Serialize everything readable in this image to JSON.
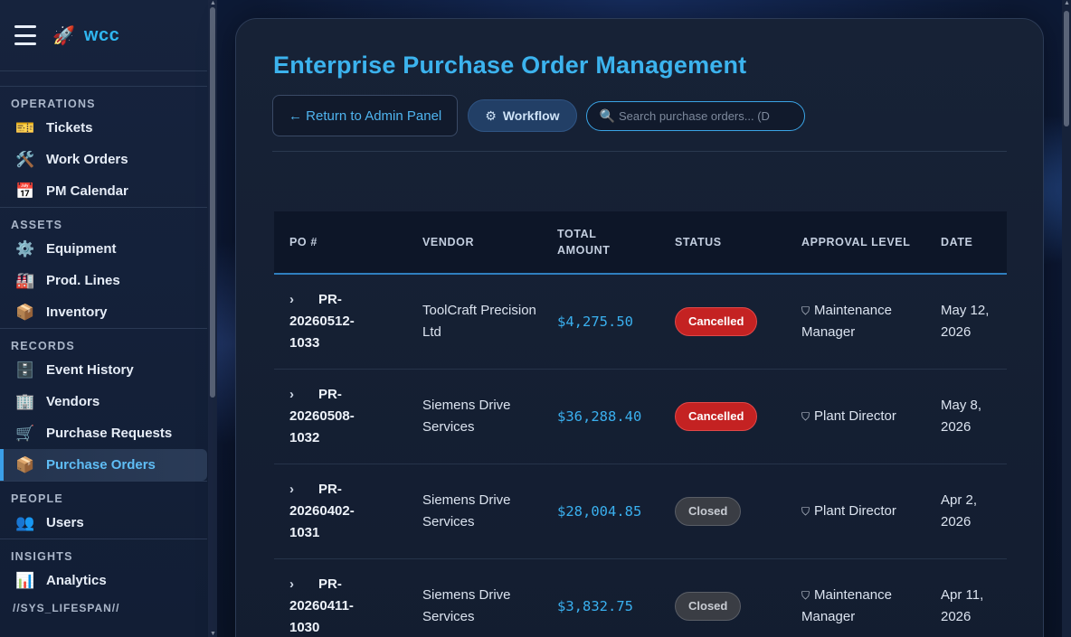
{
  "brand": {
    "name": "wcc",
    "icon": "rocket-icon"
  },
  "sidebar": {
    "sections": [
      {
        "title": "OPERATIONS",
        "items": [
          {
            "label": "Tickets",
            "icon": "🎫"
          },
          {
            "label": "Work Orders",
            "icon": "🛠️"
          },
          {
            "label": "PM Calendar",
            "icon": "📅"
          }
        ]
      },
      {
        "title": "ASSETS",
        "items": [
          {
            "label": "Equipment",
            "icon": "⚙️"
          },
          {
            "label": "Prod. Lines",
            "icon": "🏭"
          },
          {
            "label": "Inventory",
            "icon": "📦"
          }
        ]
      },
      {
        "title": "RECORDS",
        "items": [
          {
            "label": "Event History",
            "icon": "🗄️"
          },
          {
            "label": "Vendors",
            "icon": "🏢"
          },
          {
            "label": "Purchase Requests",
            "icon": "🛒"
          },
          {
            "label": "Purchase Orders",
            "icon": "📦"
          }
        ]
      },
      {
        "title": "PEOPLE",
        "items": [
          {
            "label": "Users",
            "icon": "👥"
          }
        ]
      },
      {
        "title": "INSIGHTS",
        "items": [
          {
            "label": "Analytics",
            "icon": "📊"
          }
        ]
      }
    ],
    "active": "Purchase Orders",
    "footer": "//SYS_LIFESPAN//"
  },
  "page": {
    "title": "Enterprise Purchase Order Management",
    "back_label": "← Return to Admin Panel",
    "workflow_label": "Workflow",
    "search_placeholder": "Search purchase orders... (D"
  },
  "table": {
    "headers": [
      "PO #",
      "VENDOR",
      "TOTAL AMOUNT",
      "STATUS",
      "APPROVAL LEVEL",
      "DATE"
    ],
    "rows": [
      {
        "po": "PR-20260512-1033",
        "vendor": "ToolCraft Precision Ltd",
        "amount": "$4,275.50",
        "status": "Cancelled",
        "approval": "Maintenance Manager",
        "date": "May 12, 2026"
      },
      {
        "po": "PR-20260508-1032",
        "vendor": "Siemens Drive Services",
        "amount": "$36,288.40",
        "status": "Cancelled",
        "approval": "Plant Director",
        "date": "May 8, 2026"
      },
      {
        "po": "PR-20260402-1031",
        "vendor": "Siemens Drive Services",
        "amount": "$28,004.85",
        "status": "Closed",
        "approval": "Plant Director",
        "date": "Apr 2, 2026"
      },
      {
        "po": "PR-20260411-1030",
        "vendor": "Siemens Drive Services",
        "amount": "$3,832.75",
        "status": "Closed",
        "approval": "Maintenance Manager",
        "date": "Apr 11, 2026"
      }
    ]
  },
  "colors": {
    "accent": "#3cb3ee",
    "cancelled": "#c42222",
    "closed": "#3a3d44"
  }
}
